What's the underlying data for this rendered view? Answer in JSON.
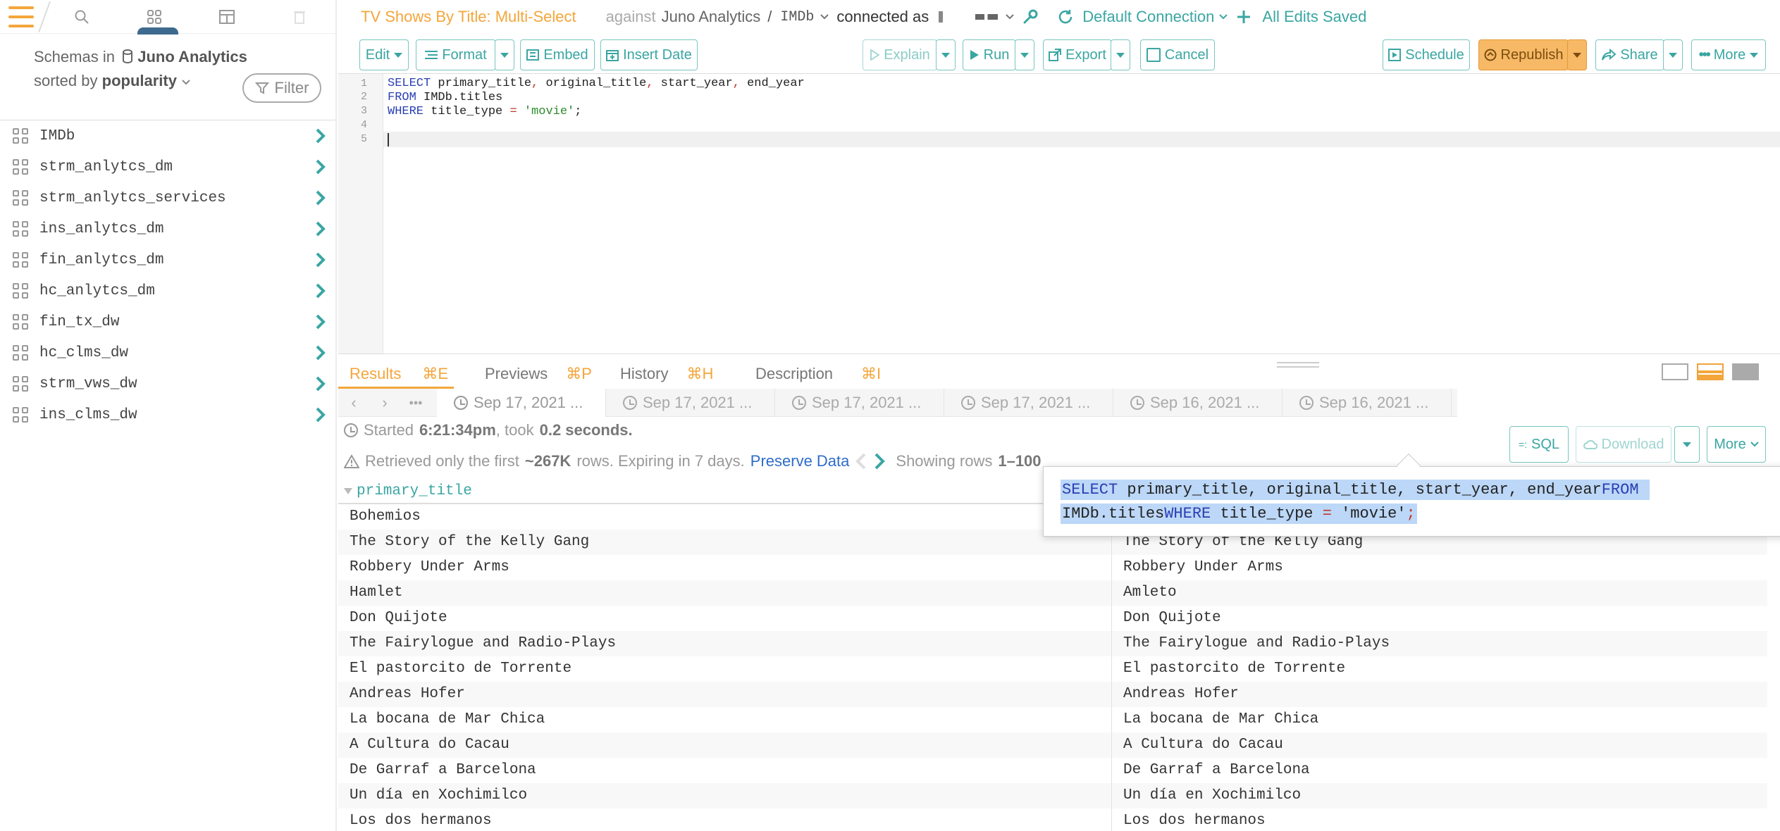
{
  "topbar": {
    "title": "TV Shows By Title: Multi-Select",
    "against": "against",
    "data_source": "Juno Analytics",
    "slash": "/",
    "schema": "IMDb",
    "connected_as": "connected as",
    "connection": "Default Connection",
    "saved_status": "All Edits Saved"
  },
  "sidebar": {
    "schemas_in": "Schemas in",
    "data_source": "Juno Analytics",
    "sorted_by": "sorted by",
    "sort": "popularity",
    "filter_label": "Filter",
    "items": [
      {
        "label": "IMDb"
      },
      {
        "label": "strm_anlytcs_dm"
      },
      {
        "label": "strm_anlytcs_services"
      },
      {
        "label": "ins_anlytcs_dm"
      },
      {
        "label": "fin_anlytcs_dm"
      },
      {
        "label": "hc_anlytcs_dm"
      },
      {
        "label": "fin_tx_dw"
      },
      {
        "label": "hc_clms_dw"
      },
      {
        "label": "strm_vws_dw"
      },
      {
        "label": "ins_clms_dw"
      }
    ]
  },
  "toolbar": {
    "edit": "Edit",
    "format": "Format",
    "embed": "Embed",
    "insert_date": "Insert Date",
    "explain": "Explain",
    "run": "Run",
    "export": "Export",
    "cancel": "Cancel",
    "schedule": "Schedule",
    "republish": "Republish",
    "share": "Share",
    "more": "More"
  },
  "editor": {
    "line_numbers": [
      "1",
      "2",
      "3",
      "4",
      "5"
    ],
    "line1": {
      "kw": "SELECT",
      "a": " primary_title",
      "b": " original_title",
      "c": " start_year",
      "d": " end_year"
    },
    "line2": {
      "kw": "FROM",
      "rest": " IMDb.titles"
    },
    "line3": {
      "kw": "WHERE",
      "rest": " title_type ",
      "op": "=",
      "str": " 'movie'",
      "end": ";"
    }
  },
  "results": {
    "tabs": [
      {
        "label": "Results",
        "shortcut": "⌘E"
      },
      {
        "label": "Previews",
        "shortcut": "⌘P"
      },
      {
        "label": "History",
        "shortcut": "⌘H"
      },
      {
        "label": "Description",
        "shortcut": "⌘I"
      }
    ],
    "history_tabs": [
      {
        "label": "Sep 17, 2021 ..."
      },
      {
        "label": "Sep 17, 2021 ..."
      },
      {
        "label": "Sep 17, 2021 ..."
      },
      {
        "label": "Sep 17, 2021 ..."
      },
      {
        "label": "Sep 16, 2021 ..."
      },
      {
        "label": "Sep 16, 2021 ..."
      }
    ],
    "started_prefix": "Started",
    "started_time": "6:21:34pm",
    "took": ", took",
    "duration": "0.2 seconds.",
    "retrieved_prefix": "Retrieved only the first",
    "row_count": "~267K",
    "retrieved_suffix": "rows. Expiring in 7 days.",
    "preserve": "Preserve Data",
    "showing": "Showing rows",
    "range": "1–100",
    "sql_btn": "SQL",
    "download_btn": "Download",
    "more_btn": "More",
    "column": "primary_title",
    "popover": {
      "line1_kw": "SELECT",
      "line1_rest": " primary_title, original_title, start_year, end_year",
      "line1_kw2": "FROM",
      "line2_a": "IMDb.titles",
      "line2_kw": "WHERE",
      "line2_b": " title_type ",
      "line2_op": "=",
      "line2_str": " 'movie'",
      "line2_end": ";"
    },
    "rows": [
      {
        "c1": "Bohemios",
        "c2": ""
      },
      {
        "c1": "The Story of the Kelly Gang",
        "c2": "The Story of the Kelly Gang"
      },
      {
        "c1": "Robbery Under Arms",
        "c2": "Robbery Under Arms"
      },
      {
        "c1": "Hamlet",
        "c2": "Amleto"
      },
      {
        "c1": "Don Quijote",
        "c2": "Don Quijote"
      },
      {
        "c1": "The Fairylogue and Radio-Plays",
        "c2": "The Fairylogue and Radio-Plays"
      },
      {
        "c1": "El pastorcito de Torrente",
        "c2": "El pastorcito de Torrente"
      },
      {
        "c1": "Andreas Hofer",
        "c2": "Andreas Hofer"
      },
      {
        "c1": "La bocana de Mar Chica",
        "c2": "La bocana de Mar Chica"
      },
      {
        "c1": "A Cultura do Cacau",
        "c2": "A Cultura do Cacau"
      },
      {
        "c1": "De Garraf a Barcelona",
        "c2": "De Garraf a Barcelona"
      },
      {
        "c1": "Un día en Xochimilco",
        "c2": "Un día en Xochimilco"
      },
      {
        "c1": "Los dos hermanos",
        "c2": "Los dos hermanos"
      }
    ]
  },
  "colors": {
    "accent": "#3aa6a2",
    "orange": "#f4a63b",
    "link": "#2e6ccb"
  },
  "icons": [
    "hamburger-icon",
    "search-icon",
    "schema-grid-icon",
    "table-icon",
    "trash-icon",
    "database-icon",
    "filter-icon",
    "chevron-right-icon",
    "wrench-icon",
    "refresh-icon",
    "plus-icon",
    "clock-icon"
  ]
}
